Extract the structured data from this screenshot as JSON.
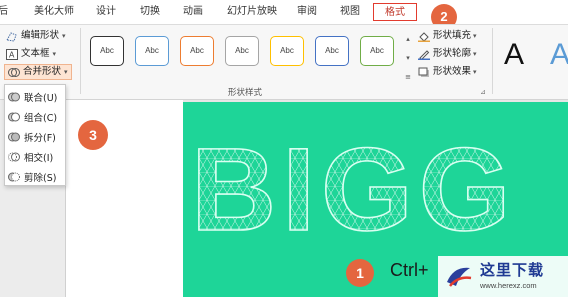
{
  "tabs": [
    {
      "label": "后"
    },
    {
      "label": "美化大师"
    },
    {
      "label": "设计"
    },
    {
      "label": "切换"
    },
    {
      "label": "动画"
    },
    {
      "label": "幻灯片放映"
    },
    {
      "label": "审阅"
    },
    {
      "label": "视图"
    },
    {
      "label": "格式",
      "active": true
    }
  ],
  "callouts": {
    "one": "1",
    "two": "2",
    "three": "3"
  },
  "insert_shapes": {
    "edit_shape": "编辑形状",
    "text_box": "文本框",
    "merge_shapes": "合并形状"
  },
  "merge_menu": [
    {
      "label": "联合(U)",
      "icon": "union-icon"
    },
    {
      "label": "组合(C)",
      "icon": "combine-icon"
    },
    {
      "label": "拆分(F)",
      "icon": "fragment-icon"
    },
    {
      "label": "相交(I)",
      "icon": "intersect-icon"
    },
    {
      "label": "剪除(S)",
      "icon": "subtract-icon"
    }
  ],
  "shape_styles": {
    "group_label": "形状样式",
    "swatch_label": "Abc",
    "swatch_colors": [
      "#333333",
      "#5b9bd5",
      "#ed7d31",
      "#a5a5a5",
      "#ffc000",
      "#4472c4",
      "#70ad47"
    ],
    "shape_fill": "形状填充",
    "shape_outline": "形状轮廓",
    "shape_effects": "形状效果"
  },
  "wordart": {
    "sample": "A"
  },
  "slide": {
    "bg_color": "#1ed598",
    "title_text": "BIGG",
    "hint": "Ctrl+"
  },
  "watermark": {
    "brand": "这里下载",
    "url": "www.herexz.com"
  }
}
